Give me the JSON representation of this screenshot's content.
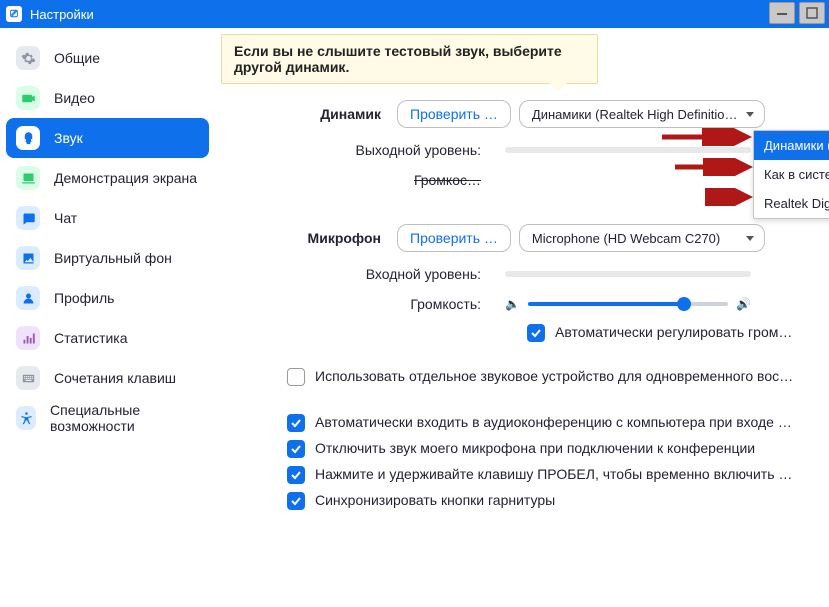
{
  "window": {
    "title": "Настройки"
  },
  "sidebar": {
    "items": [
      {
        "label": "Общие",
        "icon": "gear-icon",
        "ic_bg": "#e6e9ee",
        "ic_color": "#8e95a2"
      },
      {
        "label": "Видео",
        "icon": "video-icon",
        "ic_bg": "#d9fde7",
        "ic_color": "#2ecc71"
      },
      {
        "label": "Звук",
        "icon": "audio-icon",
        "ic_bg": "#ffffff",
        "ic_color": "#0e71eb",
        "active": true
      },
      {
        "label": "Демонстрация экрана",
        "icon": "share-icon",
        "ic_bg": "#d9fde7",
        "ic_color": "#2ecc71"
      },
      {
        "label": "Чат",
        "icon": "chat-icon",
        "ic_bg": "#dcecff",
        "ic_color": "#0e71eb"
      },
      {
        "label": "Виртуальный фон",
        "icon": "image-icon",
        "ic_bg": "#dcecff",
        "ic_color": "#0e71eb"
      },
      {
        "label": "Профиль",
        "icon": "profile-icon",
        "ic_bg": "#dcecff",
        "ic_color": "#0e71eb"
      },
      {
        "label": "Статистика",
        "icon": "stats-icon",
        "ic_bg": "#efe2fb",
        "ic_color": "#9b59b6"
      },
      {
        "label": "Сочетания клавиш",
        "icon": "keyboard-icon",
        "ic_bg": "#e6e9ee",
        "ic_color": "#8e95a2"
      },
      {
        "label": "Специальные возможности",
        "icon": "accessibility-icon",
        "ic_bg": "#dcecff",
        "ic_color": "#0e71eb"
      }
    ]
  },
  "tooltip": "Если вы не слышите тестовый звук, выберите другой динамик.",
  "speaker": {
    "label": "Динамик",
    "test_btn": "Проверить …",
    "selected": "Динамики (Realtek High Definitio…",
    "options": [
      "Динамики (Realtek High Definition Au…",
      "Как в системе",
      "Realtek Digital Output (Realtek High D…"
    ],
    "output_level_label": "Выходной уровень:",
    "volume_label_strike": "Громкос…"
  },
  "mic": {
    "label": "Микрофон",
    "test_btn": "Проверить …",
    "selected": "Microphone (HD Webcam C270)",
    "input_level_label": "Входной уровень:",
    "volume_label": "Громкость:",
    "auto_adjust": "Автоматически регулировать гром…"
  },
  "options": {
    "separate_device": "Использовать отдельное звуковое устройство для одновременного воспро…",
    "auto_join_audio": "Автоматически входить в аудиоконференцию с компьютера при входе в кон…",
    "mute_on_join": "Отключить звук моего микрофона при подключении к конференции",
    "space_unmute": "Нажмите и удерживайте клавишу ПРОБЕЛ, чтобы временно включить свой з…",
    "sync_headset": "Синхронизировать кнопки гарнитуры"
  }
}
